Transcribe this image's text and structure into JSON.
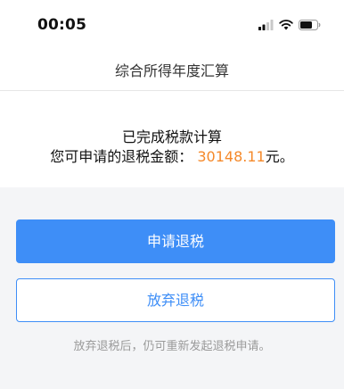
{
  "status_bar": {
    "time": "00:05",
    "icons": [
      "signal-icon",
      "wifi-icon",
      "battery-icon"
    ]
  },
  "nav": {
    "title": "综合所得年度汇算"
  },
  "result": {
    "title": "已完成税款计算",
    "refund_label": "您可申请的退税金额：",
    "refund_amount": "30148.11",
    "refund_unit": "元。"
  },
  "actions": {
    "apply_label": "申请退税",
    "abandon_label": "放弃退税",
    "hint": "放弃退税后，仍可重新发起退税申请。"
  },
  "colors": {
    "primary": "#3e8ef7",
    "amount": "#f5892a",
    "background": "#f4f5f7"
  }
}
